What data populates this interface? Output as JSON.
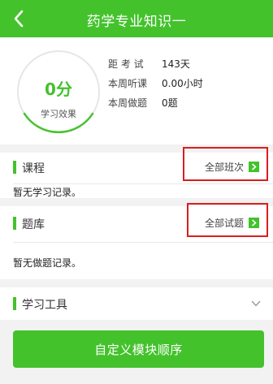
{
  "header": {
    "title": "药学专业知识一"
  },
  "summary": {
    "score": "0分",
    "score_label": "学习效果",
    "stats": [
      {
        "label": "距 考 试",
        "value": "143天"
      },
      {
        "label": "本周听课",
        "value": "0.00小时"
      },
      {
        "label": "本周做题",
        "value": "0题"
      }
    ]
  },
  "course": {
    "title": "课程",
    "link": "全部班次",
    "empty": "暂无学习记录。"
  },
  "bank": {
    "title": "题库",
    "link": "全部试题",
    "empty": "暂无做题记录。"
  },
  "tools": {
    "title": "学习工具"
  },
  "action": {
    "label": "自定义模块顺序"
  },
  "colors": {
    "accent": "#43c22c",
    "highlight": "#d91e1e"
  }
}
